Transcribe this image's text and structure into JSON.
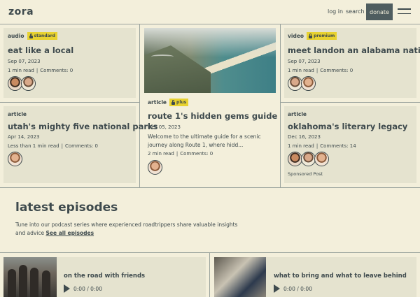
{
  "header": {
    "logo": "zora",
    "login": "log in",
    "search": "search",
    "donate": "donate"
  },
  "cards": [
    {
      "type": "audio",
      "badge": "standard",
      "title": "eat like a local",
      "date": "Sep 07, 2023",
      "read": "1 min read",
      "comments": "Comments: 0"
    },
    {
      "type": "article",
      "badge": "plus",
      "title": "route 1's hidden gems guide",
      "date": "Dec 05, 2023",
      "excerpt": "Welcome to the ultimate guide for a scenic journey along Route 1, where hidd...",
      "read": "2 min read",
      "comments": "Comments: 0"
    },
    {
      "type": "video",
      "badge": "premium",
      "title": "meet landon an alabama native",
      "date": "Sep 07, 2023",
      "read": "1 min read",
      "comments": "Comments: 0"
    },
    {
      "type": "article",
      "title": "utah's mighty five national parks",
      "date": "Apr 14, 2023",
      "read": "Less than 1 min read",
      "comments": "Comments: 0"
    },
    {
      "type": "article",
      "title": "oklahoma's literary legacy",
      "date": "Dec 16, 2023",
      "read": "1 min read",
      "comments": "Comments: 14",
      "sponsored": "Sponsored Post"
    }
  ],
  "episodes": {
    "heading": "latest episodes",
    "description": "Tune into our podcast series where experienced roadtrippers share valuable insights and advice",
    "link": "See all episodes",
    "items": [
      {
        "title": "on the road with friends",
        "time": "0:00 / 0:00"
      },
      {
        "title": "what to bring and what to leave behind",
        "time": "0:00 / 0:00"
      }
    ]
  },
  "colors": {
    "background": "#f3efdb",
    "card": "#e5e3cf",
    "badge": "#e8d230",
    "text": "#3e4a4d",
    "button": "#4f5d5f"
  }
}
